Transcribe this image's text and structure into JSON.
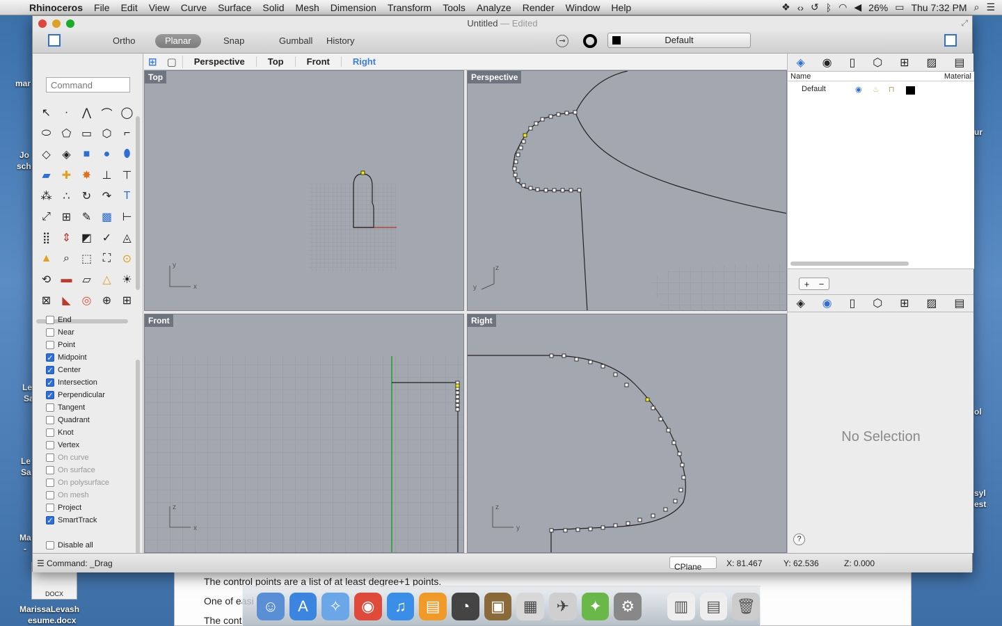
{
  "menubar": {
    "app_name": "Rhinoceros",
    "items": [
      "File",
      "Edit",
      "View",
      "Curve",
      "Surface",
      "Solid",
      "Mesh",
      "Dimension",
      "Transform",
      "Tools",
      "Analyze",
      "Render",
      "Window",
      "Help"
    ],
    "battery": "26%",
    "clock": "Thu 7:32 PM"
  },
  "desktop": {
    "labels": [
      "mar",
      "Jo",
      "sch",
      "Le",
      "Sa",
      "Le",
      "Sa",
      "Ma",
      "-",
      "ur",
      "ol",
      "syl",
      "est"
    ],
    "file_name_1": "MarissaLevash",
    "file_name_2": "esume.docx",
    "docx_tag": "DOCX"
  },
  "background_doc": {
    "line1": "The control points are a list of at least degree+1 points.",
    "line2": "One of easi",
    "line3": "The cont"
  },
  "window": {
    "title": "Untitled",
    "subtitle": "— Edited"
  },
  "toolbar": {
    "ortho": "Ortho",
    "planar": "Planar",
    "snap": "Snap",
    "gumball": "Gumball",
    "history": "History",
    "layer": "Default"
  },
  "command": {
    "placeholder": "Command"
  },
  "viewport_tabs": [
    "Perspective",
    "Top",
    "Front",
    "Right"
  ],
  "viewports": {
    "top": "Top",
    "perspective": "Perspective",
    "front": "Front",
    "right": "Right"
  },
  "snaps": [
    {
      "label": "End",
      "checked": false,
      "enabled": true
    },
    {
      "label": "Near",
      "checked": false,
      "enabled": true
    },
    {
      "label": "Point",
      "checked": false,
      "enabled": true
    },
    {
      "label": "Midpoint",
      "checked": true,
      "enabled": true
    },
    {
      "label": "Center",
      "checked": true,
      "enabled": true
    },
    {
      "label": "Intersection",
      "checked": true,
      "enabled": true
    },
    {
      "label": "Perpendicular",
      "checked": true,
      "enabled": true
    },
    {
      "label": "Tangent",
      "checked": false,
      "enabled": true
    },
    {
      "label": "Quadrant",
      "checked": false,
      "enabled": true
    },
    {
      "label": "Knot",
      "checked": false,
      "enabled": true
    },
    {
      "label": "Vertex",
      "checked": false,
      "enabled": true
    },
    {
      "label": "On curve",
      "checked": false,
      "enabled": false
    },
    {
      "label": "On surface",
      "checked": false,
      "enabled": false
    },
    {
      "label": "On polysurface",
      "checked": false,
      "enabled": false
    },
    {
      "label": "On mesh",
      "checked": false,
      "enabled": false
    },
    {
      "label": "Project",
      "checked": false,
      "enabled": true
    },
    {
      "label": "SmartTrack",
      "checked": true,
      "enabled": true
    },
    {
      "label": "Disable all",
      "checked": false,
      "enabled": true
    }
  ],
  "layers": {
    "col_name": "Name",
    "col_material": "Material",
    "rows": [
      {
        "name": "Default"
      }
    ]
  },
  "properties": {
    "no_selection": "No Selection",
    "help": "?"
  },
  "status": {
    "command": "Command:  _Drag",
    "cplane": "CPlane",
    "x": "X: 81.467",
    "y": "Y: 62.536",
    "z": "Z: 0.000"
  },
  "colors": {
    "accent": "#3b7de0",
    "viewport_bg": "#a3a8b0",
    "grid_green": "#1f9a2a",
    "grid_red": "#b8322a",
    "point_yellow": "#f4f000"
  }
}
